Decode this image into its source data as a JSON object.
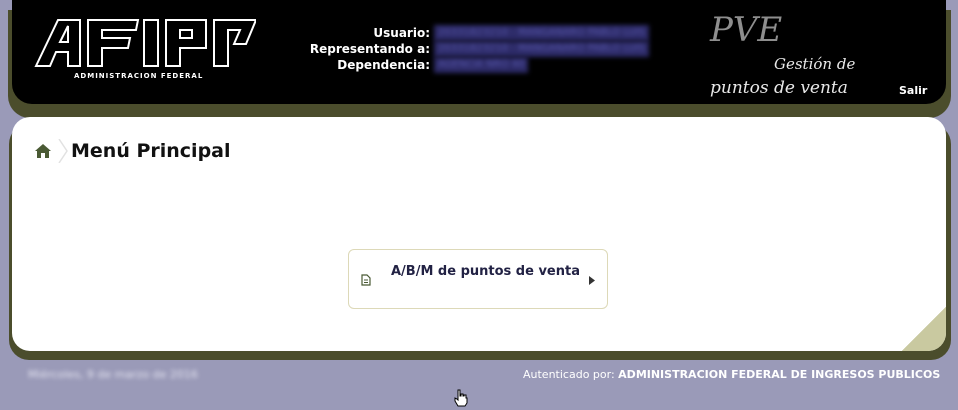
{
  "header": {
    "logo_subtitle": "ADMINISTRACION FEDERAL",
    "user_info": [
      {
        "label": "Usuario:",
        "value": "20331823210 - MANGANARO PABLO LUIS"
      },
      {
        "label": "Representando a:",
        "value": "20331823210 - MANGANARO PABLO LUIS"
      },
      {
        "label": "Dependencia:",
        "value": "AGENCIA NRO 40"
      }
    ],
    "app_title": "PVE",
    "app_subtitle_1": "Gestión de",
    "app_subtitle_2": "puntos de venta",
    "logout_label": "Salir"
  },
  "main": {
    "page_title": "Menú Principal",
    "menu_items": [
      {
        "label": "A/B/M de puntos de venta"
      }
    ]
  },
  "footer": {
    "date": "Miércoles, 9 de marzo de 2016",
    "auth_label": "Autenticado por:",
    "auth_org": "ADMINISTRACION FEDERAL DE INGRESOS PUBLICOS"
  },
  "icons": {
    "home": "home-icon",
    "document": "document-icon",
    "arrow": "arrow-right-icon",
    "cursor": "hand-cursor-icon"
  },
  "colors": {
    "background": "#9a9ab8",
    "header": "#000000",
    "shadow": "#4b4d2c",
    "accent": "#c9c9a0"
  }
}
